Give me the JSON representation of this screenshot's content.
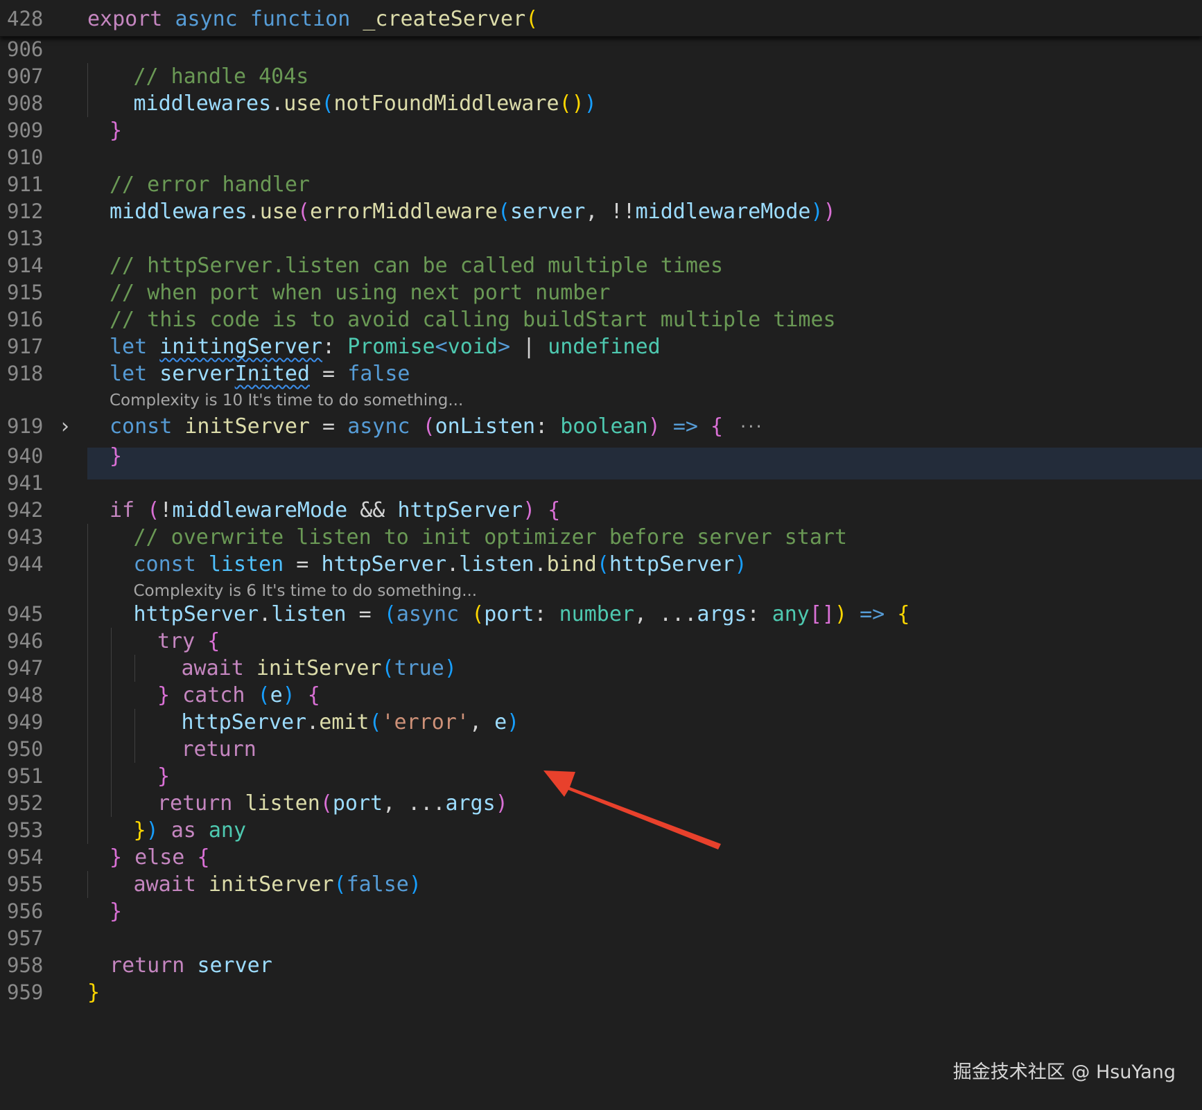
{
  "editor": {
    "sticky_header": {
      "line_number": "428",
      "tokens": [
        {
          "t": "export",
          "c": "kw"
        },
        {
          "t": " ",
          "c": "pl"
        },
        {
          "t": "async",
          "c": "st"
        },
        {
          "t": " ",
          "c": "pl"
        },
        {
          "t": "function",
          "c": "st"
        },
        {
          "t": " ",
          "c": "pl"
        },
        {
          "t": "_createServer",
          "c": "fn"
        },
        {
          "t": "(",
          "c": "b1"
        }
      ]
    },
    "lines": [
      {
        "n": "906",
        "indent": 0,
        "tokens": []
      },
      {
        "n": "907",
        "indent": 2,
        "tokens": [
          {
            "t": "// handle 404s",
            "c": "cm"
          }
        ]
      },
      {
        "n": "908",
        "indent": 2,
        "tokens": [
          {
            "t": "middlewares",
            "c": "va"
          },
          {
            "t": ".",
            "c": "pl"
          },
          {
            "t": "use",
            "c": "fn"
          },
          {
            "t": "(",
            "c": "b3"
          },
          {
            "t": "notFoundMiddleware",
            "c": "fn"
          },
          {
            "t": "()",
            "c": "b1"
          },
          {
            "t": ")",
            "c": "b3"
          }
        ]
      },
      {
        "n": "909",
        "indent": 1,
        "tokens": [
          {
            "t": "}",
            "c": "b2"
          }
        ]
      },
      {
        "n": "910",
        "indent": 0,
        "tokens": []
      },
      {
        "n": "911",
        "indent": 1,
        "tokens": [
          {
            "t": "// error handler",
            "c": "cm"
          }
        ]
      },
      {
        "n": "912",
        "indent": 1,
        "tokens": [
          {
            "t": "middlewares",
            "c": "va"
          },
          {
            "t": ".",
            "c": "pl"
          },
          {
            "t": "use",
            "c": "fn"
          },
          {
            "t": "(",
            "c": "b2"
          },
          {
            "t": "errorMiddleware",
            "c": "fn"
          },
          {
            "t": "(",
            "c": "b3"
          },
          {
            "t": "server",
            "c": "va"
          },
          {
            "t": ", ",
            "c": "pl"
          },
          {
            "t": "!!",
            "c": "pl"
          },
          {
            "t": "middlewareMode",
            "c": "va"
          },
          {
            "t": ")",
            "c": "b3"
          },
          {
            "t": ")",
            "c": "b2"
          }
        ]
      },
      {
        "n": "913",
        "indent": 0,
        "tokens": []
      },
      {
        "n": "914",
        "indent": 1,
        "tokens": [
          {
            "t": "// httpServer.listen can be called multiple times",
            "c": "cm"
          }
        ]
      },
      {
        "n": "915",
        "indent": 1,
        "tokens": [
          {
            "t": "// when port when using next port number",
            "c": "cm"
          }
        ]
      },
      {
        "n": "916",
        "indent": 1,
        "tokens": [
          {
            "t": "// this code is to avoid calling buildStart multiple times",
            "c": "cm"
          }
        ]
      },
      {
        "n": "917",
        "indent": 1,
        "tokens": [
          {
            "t": "let",
            "c": "st"
          },
          {
            "t": " ",
            "c": "pl"
          },
          {
            "t": "initingServer",
            "c": "va",
            "sq": true
          },
          {
            "t": ": ",
            "c": "pl"
          },
          {
            "t": "Promise",
            "c": "ty"
          },
          {
            "t": "<",
            "c": "st"
          },
          {
            "t": "void",
            "c": "ty"
          },
          {
            "t": ">",
            "c": "st"
          },
          {
            "t": " | ",
            "c": "pl"
          },
          {
            "t": "undefined",
            "c": "ty"
          }
        ]
      },
      {
        "n": "918",
        "indent": 1,
        "tokens": [
          {
            "t": "let",
            "c": "st"
          },
          {
            "t": " ",
            "c": "pl"
          },
          {
            "t": "server",
            "c": "va"
          },
          {
            "t": "Inited",
            "c": "va",
            "sq": true
          },
          {
            "t": " = ",
            "c": "pl"
          },
          {
            "t": "false",
            "c": "st"
          }
        ]
      },
      {
        "lens": "Complexity is 10 It's time to do something...",
        "indent": 1
      },
      {
        "n": "919",
        "indent": 1,
        "fold": true,
        "tokens": [
          {
            "t": "const",
            "c": "st"
          },
          {
            "t": " ",
            "c": "pl"
          },
          {
            "t": "initServer",
            "c": "fn"
          },
          {
            "t": " = ",
            "c": "pl"
          },
          {
            "t": "async",
            "c": "st"
          },
          {
            "t": " ",
            "c": "pl"
          },
          {
            "t": "(",
            "c": "b2"
          },
          {
            "t": "onListen",
            "c": "va"
          },
          {
            "t": ": ",
            "c": "pl"
          },
          {
            "t": "boolean",
            "c": "ty"
          },
          {
            "t": ")",
            "c": "b2"
          },
          {
            "t": " ",
            "c": "pl"
          },
          {
            "t": "=>",
            "c": "st"
          },
          {
            "t": " ",
            "c": "pl"
          },
          {
            "t": "{",
            "c": "b2"
          }
        ]
      },
      {
        "n": "940",
        "indent": 1,
        "tokens": [
          {
            "t": "}",
            "c": "b2"
          }
        ]
      },
      {
        "n": "941",
        "indent": 0,
        "tokens": []
      },
      {
        "n": "942",
        "indent": 1,
        "tokens": [
          {
            "t": "if",
            "c": "kw"
          },
          {
            "t": " ",
            "c": "pl"
          },
          {
            "t": "(",
            "c": "b2"
          },
          {
            "t": "!",
            "c": "pl"
          },
          {
            "t": "middlewareMode",
            "c": "va"
          },
          {
            "t": " && ",
            "c": "pl"
          },
          {
            "t": "httpServer",
            "c": "va"
          },
          {
            "t": ")",
            "c": "b2"
          },
          {
            "t": " ",
            "c": "pl"
          },
          {
            "t": "{",
            "c": "b2"
          }
        ]
      },
      {
        "n": "943",
        "indent": 2,
        "tokens": [
          {
            "t": "// overwrite listen to init optimizer before server start",
            "c": "cm"
          }
        ]
      },
      {
        "n": "944",
        "indent": 2,
        "tokens": [
          {
            "t": "const",
            "c": "st"
          },
          {
            "t": " ",
            "c": "pl"
          },
          {
            "t": "listen",
            "c": "vb"
          },
          {
            "t": " = ",
            "c": "pl"
          },
          {
            "t": "httpServer",
            "c": "va"
          },
          {
            "t": ".",
            "c": "pl"
          },
          {
            "t": "listen",
            "c": "va"
          },
          {
            "t": ".",
            "c": "pl"
          },
          {
            "t": "bind",
            "c": "fn"
          },
          {
            "t": "(",
            "c": "b3"
          },
          {
            "t": "httpServer",
            "c": "va"
          },
          {
            "t": ")",
            "c": "b3"
          }
        ]
      },
      {
        "lens": "Complexity is 6 It's time to do something...",
        "indent": 2
      },
      {
        "n": "945",
        "indent": 2,
        "tokens": [
          {
            "t": "httpServer",
            "c": "va"
          },
          {
            "t": ".",
            "c": "pl"
          },
          {
            "t": "listen",
            "c": "va"
          },
          {
            "t": " = ",
            "c": "pl"
          },
          {
            "t": "(",
            "c": "b3"
          },
          {
            "t": "async",
            "c": "st"
          },
          {
            "t": " ",
            "c": "pl"
          },
          {
            "t": "(",
            "c": "b1"
          },
          {
            "t": "port",
            "c": "va"
          },
          {
            "t": ": ",
            "c": "pl"
          },
          {
            "t": "number",
            "c": "ty"
          },
          {
            "t": ", ",
            "c": "pl"
          },
          {
            "t": "...",
            "c": "pl"
          },
          {
            "t": "args",
            "c": "va"
          },
          {
            "t": ": ",
            "c": "pl"
          },
          {
            "t": "any",
            "c": "ty"
          },
          {
            "t": "[]",
            "c": "b2"
          },
          {
            "t": ")",
            "c": "b1"
          },
          {
            "t": " ",
            "c": "pl"
          },
          {
            "t": "=>",
            "c": "st"
          },
          {
            "t": " ",
            "c": "pl"
          },
          {
            "t": "{",
            "c": "b1"
          }
        ]
      },
      {
        "n": "946",
        "indent": 3,
        "tokens": [
          {
            "t": "try",
            "c": "kw"
          },
          {
            "t": " ",
            "c": "pl"
          },
          {
            "t": "{",
            "c": "b2"
          }
        ]
      },
      {
        "n": "947",
        "indent": 4,
        "tokens": [
          {
            "t": "await",
            "c": "kw"
          },
          {
            "t": " ",
            "c": "pl"
          },
          {
            "t": "initServer",
            "c": "fn"
          },
          {
            "t": "(",
            "c": "b3"
          },
          {
            "t": "true",
            "c": "st"
          },
          {
            "t": ")",
            "c": "b3"
          }
        ]
      },
      {
        "n": "948",
        "indent": 3,
        "tokens": [
          {
            "t": "}",
            "c": "b2"
          },
          {
            "t": " ",
            "c": "pl"
          },
          {
            "t": "catch",
            "c": "kw"
          },
          {
            "t": " ",
            "c": "pl"
          },
          {
            "t": "(",
            "c": "b3"
          },
          {
            "t": "e",
            "c": "va"
          },
          {
            "t": ")",
            "c": "b3"
          },
          {
            "t": " ",
            "c": "pl"
          },
          {
            "t": "{",
            "c": "b2"
          }
        ]
      },
      {
        "n": "949",
        "indent": 4,
        "tokens": [
          {
            "t": "httpServer",
            "c": "va"
          },
          {
            "t": ".",
            "c": "pl"
          },
          {
            "t": "emit",
            "c": "fn"
          },
          {
            "t": "(",
            "c": "b3"
          },
          {
            "t": "'error'",
            "c": "str"
          },
          {
            "t": ", ",
            "c": "pl"
          },
          {
            "t": "e",
            "c": "va"
          },
          {
            "t": ")",
            "c": "b3"
          }
        ]
      },
      {
        "n": "950",
        "indent": 4,
        "tokens": [
          {
            "t": "return",
            "c": "kw"
          }
        ]
      },
      {
        "n": "951",
        "indent": 3,
        "tokens": [
          {
            "t": "}",
            "c": "b2"
          }
        ]
      },
      {
        "n": "952",
        "indent": 3,
        "tokens": [
          {
            "t": "return",
            "c": "kw"
          },
          {
            "t": " ",
            "c": "pl"
          },
          {
            "t": "listen",
            "c": "fn"
          },
          {
            "t": "(",
            "c": "b2"
          },
          {
            "t": "port",
            "c": "va"
          },
          {
            "t": ", ",
            "c": "pl"
          },
          {
            "t": "...",
            "c": "pl"
          },
          {
            "t": "args",
            "c": "va"
          },
          {
            "t": ")",
            "c": "b2"
          }
        ]
      },
      {
        "n": "953",
        "indent": 2,
        "tokens": [
          {
            "t": "}",
            "c": "b1"
          },
          {
            "t": ")",
            "c": "b3"
          },
          {
            "t": " ",
            "c": "pl"
          },
          {
            "t": "as",
            "c": "kw"
          },
          {
            "t": " ",
            "c": "pl"
          },
          {
            "t": "any",
            "c": "ty"
          }
        ]
      },
      {
        "n": "954",
        "indent": 1,
        "tokens": [
          {
            "t": "}",
            "c": "b2"
          },
          {
            "t": " ",
            "c": "pl"
          },
          {
            "t": "else",
            "c": "kw"
          },
          {
            "t": " ",
            "c": "pl"
          },
          {
            "t": "{",
            "c": "b2"
          }
        ]
      },
      {
        "n": "955",
        "indent": 2,
        "tokens": [
          {
            "t": "await",
            "c": "kw"
          },
          {
            "t": " ",
            "c": "pl"
          },
          {
            "t": "initServer",
            "c": "fn"
          },
          {
            "t": "(",
            "c": "b3"
          },
          {
            "t": "false",
            "c": "st"
          },
          {
            "t": ")",
            "c": "b3"
          }
        ]
      },
      {
        "n": "956",
        "indent": 1,
        "tokens": [
          {
            "t": "}",
            "c": "b2"
          }
        ]
      },
      {
        "n": "957",
        "indent": 0,
        "tokens": []
      },
      {
        "n": "958",
        "indent": 1,
        "tokens": [
          {
            "t": "return",
            "c": "kw"
          },
          {
            "t": " ",
            "c": "pl"
          },
          {
            "t": "server",
            "c": "va"
          }
        ]
      },
      {
        "n": "959",
        "indent": 0,
        "tokens": [
          {
            "t": "}",
            "c": "b1"
          }
        ]
      }
    ]
  },
  "annotation": {
    "type": "arrow",
    "color": "#e8412c"
  },
  "watermark": "掘金技术社区 @ HsuYang"
}
